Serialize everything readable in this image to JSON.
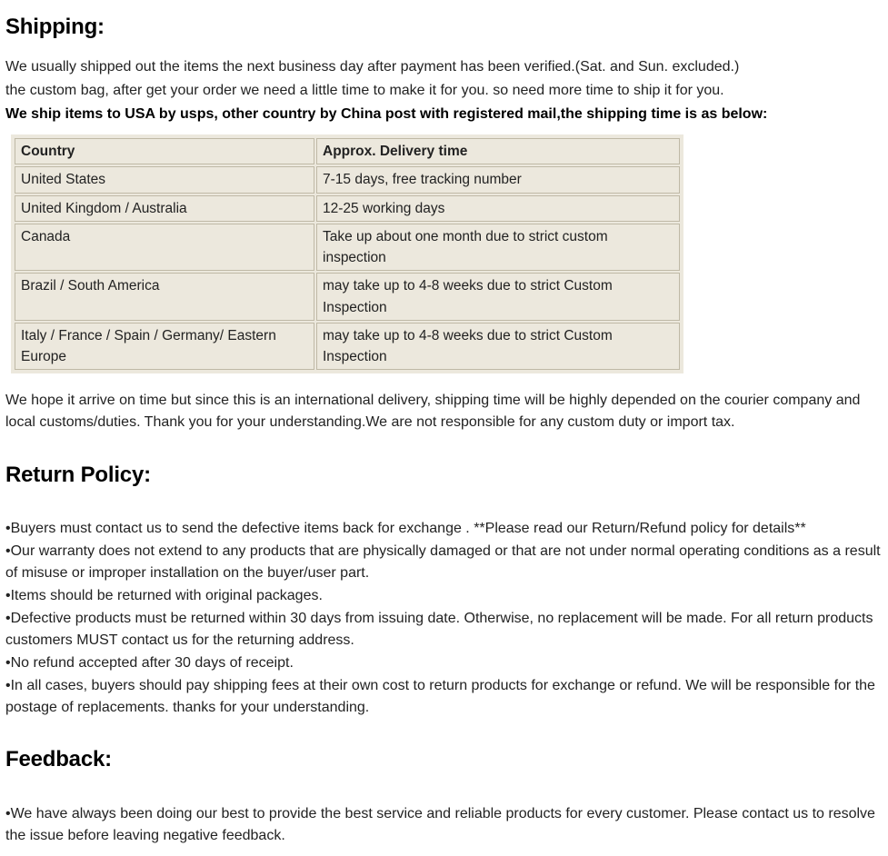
{
  "shipping": {
    "heading": "Shipping:",
    "p1": "We usually shipped out the items the next business day after payment has been verified.(Sat. and Sun. excluded.)",
    "p2": "the custom bag, after get your order we need a little time to make it for you. so need more time to ship it for you.",
    "p3": "We ship items to USA by usps, other country by China post with registered mail,the shipping time is as below:",
    "table": {
      "h_country": "Country",
      "h_delivery": "Approx. Delivery time",
      "rows": [
        {
          "country": "United States",
          "time": "7-15 days, free tracking number",
          "style": ""
        },
        {
          "country": "United Kingdom / Australia",
          "time": "12-25 working days",
          "style": "dim"
        },
        {
          "country": "Canada",
          "time": "Take up about one month due to strict custom inspection",
          "style": "red"
        },
        {
          "country": "Brazil / South America",
          "time": "may take up to 4-8 weeks due to strict Custom Inspection",
          "style": ""
        },
        {
          "country": "Italy / France / Spain / Germany/ Eastern Europe",
          "time": "may take up to 4-8 weeks due to strict Custom Inspection",
          "style": ""
        }
      ]
    },
    "p4": "We hope it arrive on time but since this is an international delivery, shipping time will be highly depended on the courier company and local customs/duties. Thank you for your understanding.We are not responsible for any custom duty or import tax."
  },
  "return": {
    "heading": "Return Policy:",
    "items": [
      "•Buyers must contact us to send the defective items back for exchange . **Please read our Return/Refund policy for details**",
      "•Our warranty does not extend to any products that are physically damaged or that are not under normal operating conditions as a result of misuse or improper installation on the buyer/user part.",
      "•Items should be returned with original packages.",
      "•Defective products must be returned within 30 days from issuing date. Otherwise, no replacement will be made. For all return products customers MUST contact us for the returning address.",
      "•No refund accepted after 30 days of receipt.",
      "•In all cases, buyers should pay shipping fees at their own cost to return products for exchange or refund. We will be responsible for the postage of replacements. thanks for your understanding."
    ]
  },
  "feedback": {
    "heading": "Feedback:",
    "p1": "•We have always been doing our best to provide the best service and reliable products for every customer. Please contact us to resolve the issue before leaving negative feedback."
  }
}
